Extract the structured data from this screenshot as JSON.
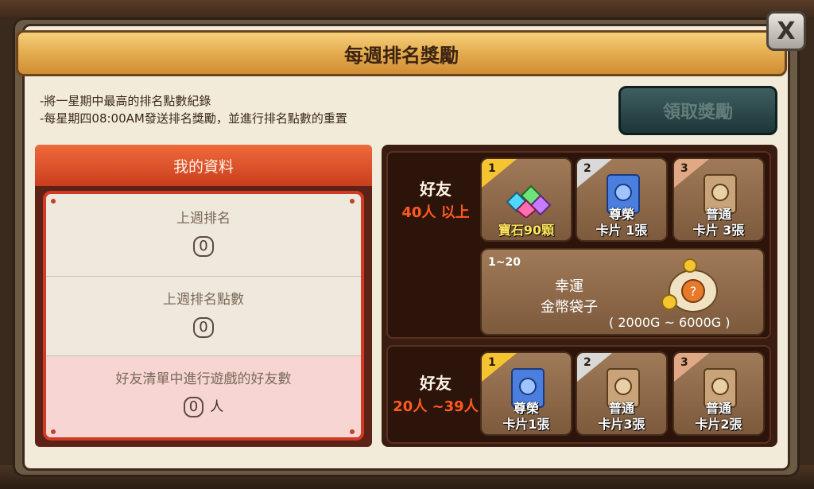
{
  "header": {
    "title": "每週排名獎勵",
    "close_label": "X"
  },
  "rules": [
    "-將一星期中最高的排名點數紀錄",
    "-每星期四08:00AM發送排名獎勵，並進行排名點數的重置"
  ],
  "claim_button": {
    "label": "領取獎勵",
    "state": "disabled"
  },
  "my_info": {
    "title": "我的資料",
    "last_week_rank_label": "上週排名",
    "last_week_rank_value": "0",
    "last_week_points_label": "上週排名點數",
    "last_week_points_value": "0",
    "friends_playing_label": "好友清單中進行遊戲的好友數",
    "friends_playing_value": "0",
    "friends_playing_unit": "人"
  },
  "tiers": [
    {
      "friends_label": "好友",
      "range": "40人 以上",
      "rewards": [
        {
          "rank": "1",
          "line1": "寶石90顆",
          "line2": "",
          "icon": "gem-pile-icon"
        },
        {
          "rank": "2",
          "line1": "尊榮",
          "line2": "卡片 1張",
          "icon": "honor-card-icon"
        },
        {
          "rank": "3",
          "line1": "普通",
          "line2": "卡片 3張",
          "icon": "normal-card-icon"
        }
      ],
      "lucky": {
        "rank": "1~20",
        "line1": "幸運",
        "line2": "金幣袋子",
        "range": "( 2000G ~ 6000G )",
        "icon": "coin-bag-icon"
      }
    },
    {
      "friends_label": "好友",
      "range": "20人 ~39人",
      "rewards": [
        {
          "rank": "1",
          "line1": "尊榮",
          "line2": "卡片1張",
          "icon": "honor-card-icon"
        },
        {
          "rank": "2",
          "line1": "普通",
          "line2": "卡片3張",
          "icon": "normal-card-icon"
        },
        {
          "rank": "3",
          "line1": "普通",
          "line2": "卡片2張",
          "icon": "normal-card-icon"
        }
      ]
    }
  ],
  "colors": {
    "accent_orange": "#ff5a1e",
    "header_red": "#d9482a",
    "title_gold": "#e2a94b"
  }
}
